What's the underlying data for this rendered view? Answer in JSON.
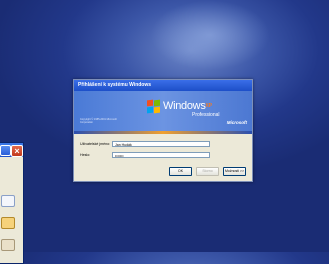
{
  "dialog": {
    "title": "Přihlášení k systému Windows",
    "product_brand": "Windows",
    "product_version": "XP",
    "product_edition": "Professional",
    "copyright": "Copyright © 1985-2001 Microsoft Corporation",
    "vendor": "Microsoft",
    "username_label": "Uživatelské jméno:",
    "username_value": "Jan Hudák",
    "password_label": "Heslo:",
    "password_value": "•••••••",
    "ok_label": "OK",
    "cancel_label": "Storno",
    "options_label": "Možnosti >>"
  },
  "side_window": {
    "close_glyph": "×"
  },
  "colors": {
    "desktop": "#2a4296",
    "titlebar": "#1d4fc8",
    "dialog_bg": "#ece9d8",
    "close_red": "#c0391c"
  }
}
